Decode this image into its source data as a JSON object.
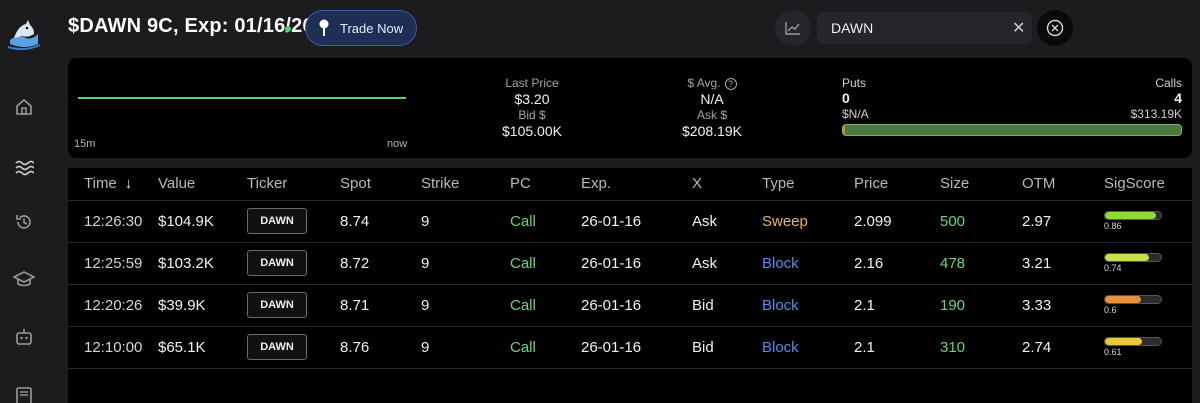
{
  "header": {
    "title": "$DAWN 9C, Exp: 01/16/26",
    "trade_button": "Trade Now",
    "search_value": "DAWN",
    "search_clear_glyph": "✕",
    "live_color": "#4cd26b"
  },
  "sidebar": {
    "items": [
      "home-icon",
      "waves-icon",
      "history-icon",
      "education-icon",
      "bot-icon",
      "news-icon"
    ]
  },
  "stats": {
    "range_start": "15m",
    "range_end": "now",
    "last_price_label": "Last Price",
    "last_price": "$3.20",
    "bid_label": "Bid $",
    "bid": "$105.00K",
    "avg_label": "$ Avg.",
    "avg": "N/A",
    "ask_label": "Ask $",
    "ask": "$208.19K",
    "puts_label": "Puts",
    "puts_count": "0",
    "puts_amount": "$N/A",
    "calls_label": "Calls",
    "calls_count": "4",
    "calls_amount": "$313.19K",
    "puts_fraction": 0.005
  },
  "table": {
    "columns": [
      "Time",
      "Value",
      "Ticker",
      "Spot",
      "Strike",
      "PC",
      "Exp.",
      "X",
      "Type",
      "Price",
      "Size",
      "OTM",
      "SigScore"
    ],
    "sort_icon": "↓",
    "rows": [
      {
        "time": "12:26:30",
        "value": "$104.9K",
        "ticker": "DAWN",
        "spot": "8.74",
        "strike": "9",
        "pc": "Call",
        "exp": "26-01-16",
        "x": "Ask",
        "type": "Sweep",
        "price": "2.099",
        "size": "500",
        "otm": "2.97",
        "sig": "0.86",
        "sig_color": "#8bdc3a"
      },
      {
        "time": "12:25:59",
        "value": "$103.2K",
        "ticker": "DAWN",
        "spot": "8.72",
        "strike": "9",
        "pc": "Call",
        "exp": "26-01-16",
        "x": "Ask",
        "type": "Block",
        "price": "2.16",
        "size": "478",
        "otm": "3.21",
        "sig": "0.74",
        "sig_color": "#c4e04a"
      },
      {
        "time": "12:20:26",
        "value": "$39.9K",
        "ticker": "DAWN",
        "spot": "8.71",
        "strike": "9",
        "pc": "Call",
        "exp": "26-01-16",
        "x": "Bid",
        "type": "Block",
        "price": "2.1",
        "size": "190",
        "otm": "3.33",
        "sig": "0.6",
        "sig_color": "#e9923a"
      },
      {
        "time": "12:10:00",
        "value": "$65.1K",
        "ticker": "DAWN",
        "spot": "8.76",
        "strike": "9",
        "pc": "Call",
        "exp": "26-01-16",
        "x": "Bid",
        "type": "Block",
        "price": "2.1",
        "size": "310",
        "otm": "2.74",
        "sig": "0.61",
        "sig_color": "#e8c93e"
      }
    ]
  },
  "colors": {
    "sweep": "#e8b659",
    "block": "#4d8ef0",
    "call": "#62d87e",
    "sparkline": "#4cd26b"
  }
}
